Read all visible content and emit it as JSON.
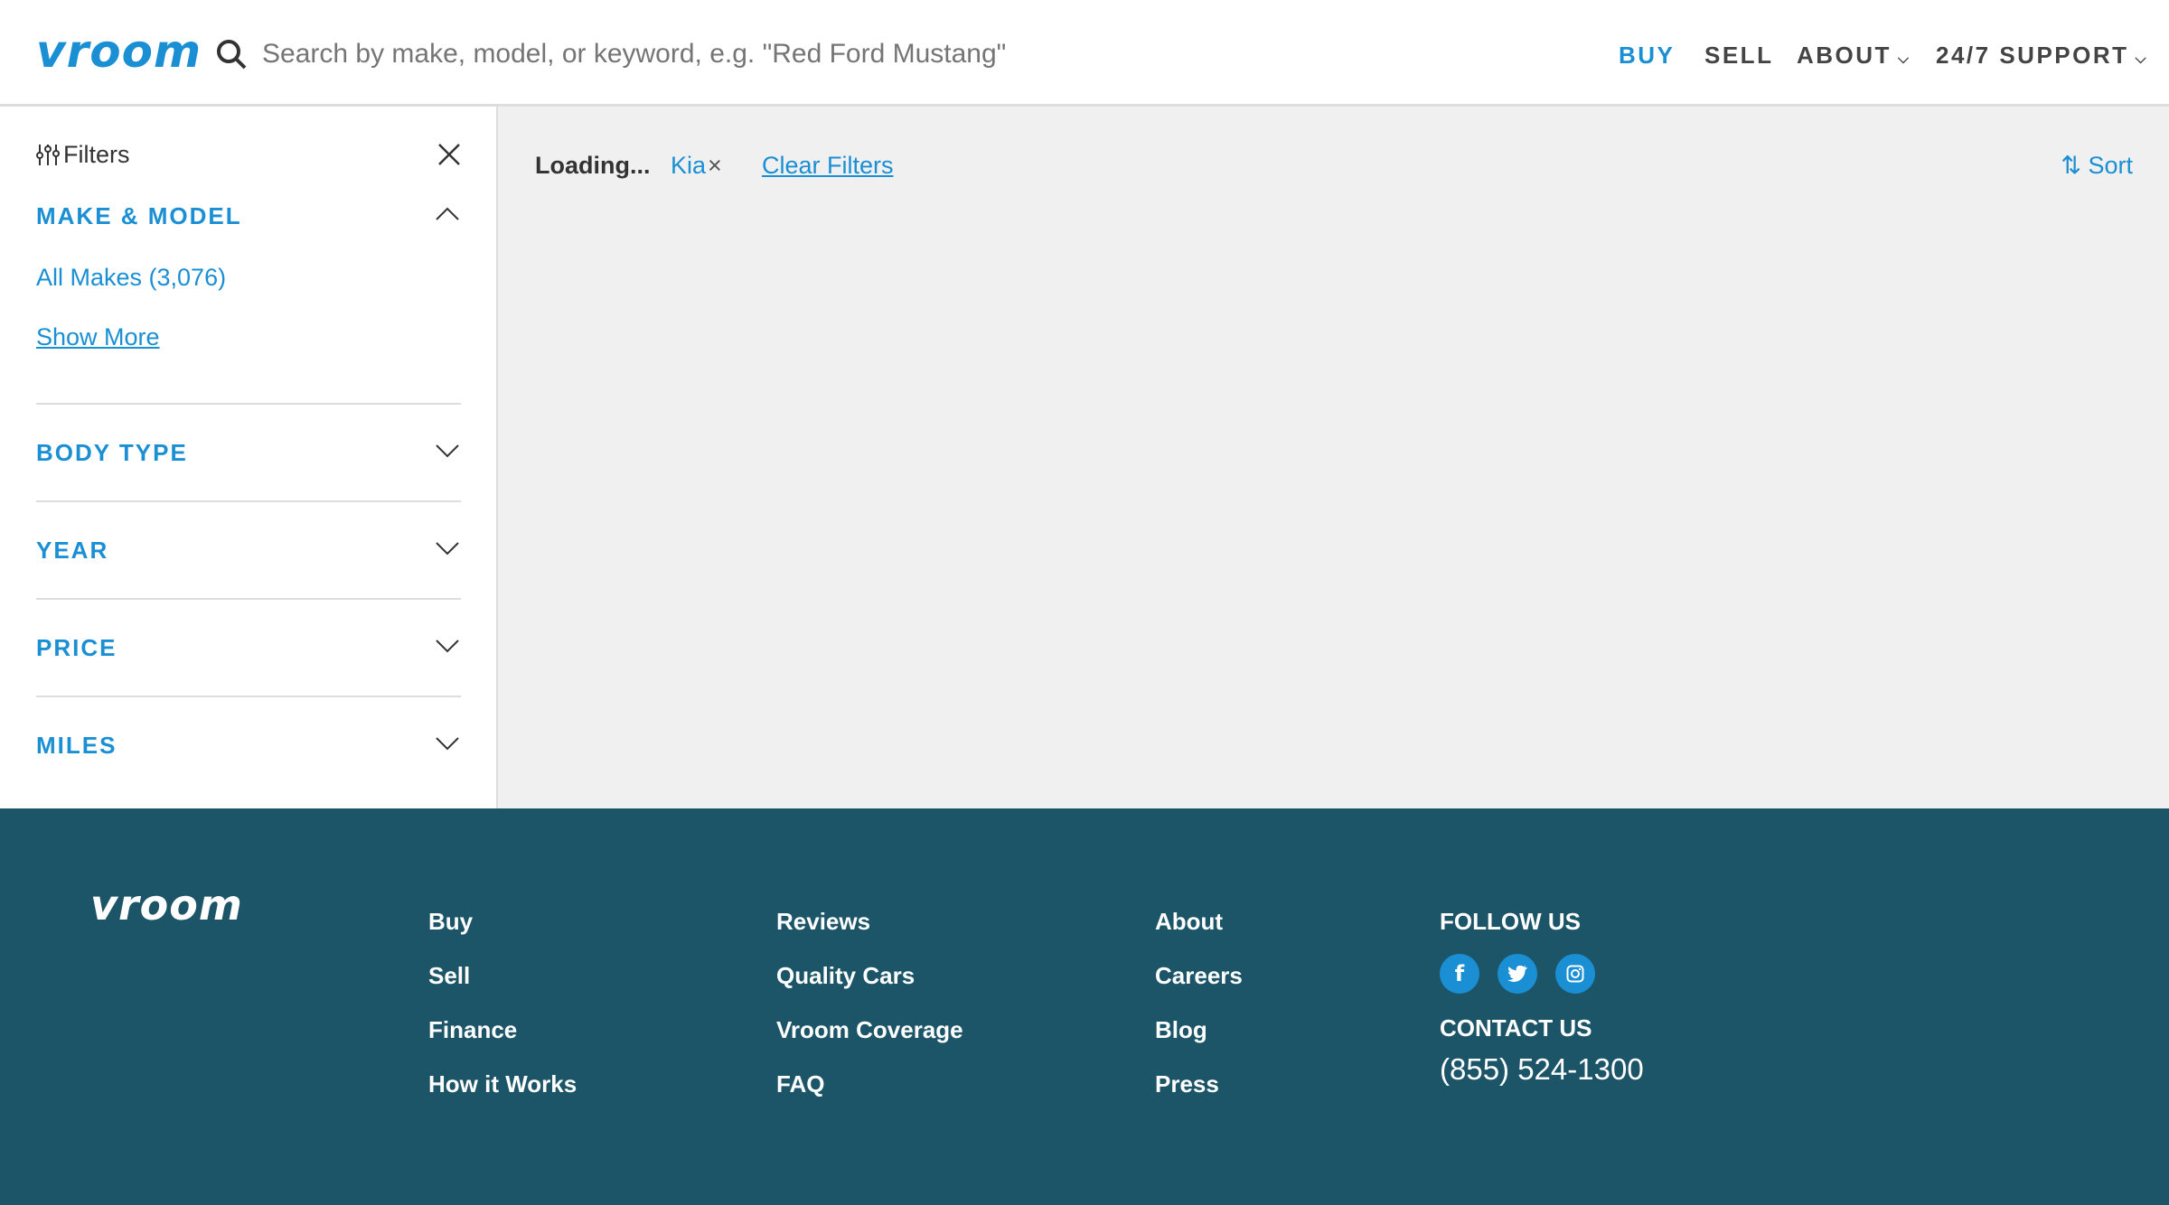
{
  "header": {
    "logo": "vroom",
    "search_placeholder": "Search by make, model, or keyword, e.g. \"Red Ford Mustang\"",
    "nav": [
      "BUY",
      "SELL",
      "ABOUT",
      "24/7 SUPPORT"
    ]
  },
  "sidebar": {
    "title": "Filters",
    "sections": [
      {
        "label": "MAKE & MODEL",
        "expanded": true
      },
      {
        "label": "BODY TYPE"
      },
      {
        "label": "YEAR"
      },
      {
        "label": "PRICE"
      },
      {
        "label": "MILES"
      }
    ],
    "all_makes": "All Makes (3,076)",
    "show_more": "Show More"
  },
  "main": {
    "status": "Loading...",
    "chip": "Kia",
    "chip_remove": "×",
    "clear": "Clear Filters",
    "sort": "Sort"
  },
  "footer": {
    "logo": "vroom",
    "col1": [
      "Buy",
      "Sell",
      "Finance",
      "How it Works"
    ],
    "col2": [
      "Reviews",
      "Quality Cars",
      "Vroom Coverage",
      "FAQ"
    ],
    "col3": [
      "About",
      "Careers",
      "Blog",
      "Press"
    ],
    "follow": "FOLLOW US",
    "contact": "CONTACT US",
    "phone": "(855) 524-1300",
    "social": [
      "facebook-icon",
      "twitter-icon",
      "instagram-icon"
    ]
  },
  "colors": {
    "brand": "#1a8fd4",
    "footer": "#1c5568"
  }
}
